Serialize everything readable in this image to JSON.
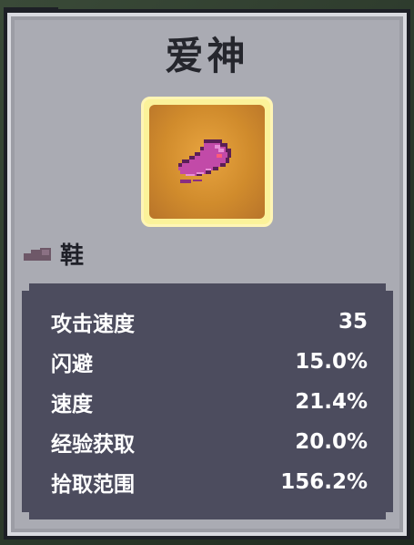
{
  "item": {
    "title": "爱神",
    "category_label": "鞋",
    "icon_name": "pink-shoe-icon",
    "category_icon_name": "shoe-category-icon"
  },
  "stats": [
    {
      "label": "攻击速度",
      "value": "35"
    },
    {
      "label": "闪避",
      "value": "15.0%"
    },
    {
      "label": "速度",
      "value": "21.4%"
    },
    {
      "label": "经验获取",
      "value": "20.0%"
    },
    {
      "label": "拾取范围",
      "value": "156.2%"
    }
  ],
  "colors": {
    "card_bg": "#aeafb6",
    "stats_bg": "#4c4c5e",
    "icon_gold": "#d08b2c",
    "icon_highlight": "#fbf29a",
    "shoe_pink": "#c24aa8"
  }
}
